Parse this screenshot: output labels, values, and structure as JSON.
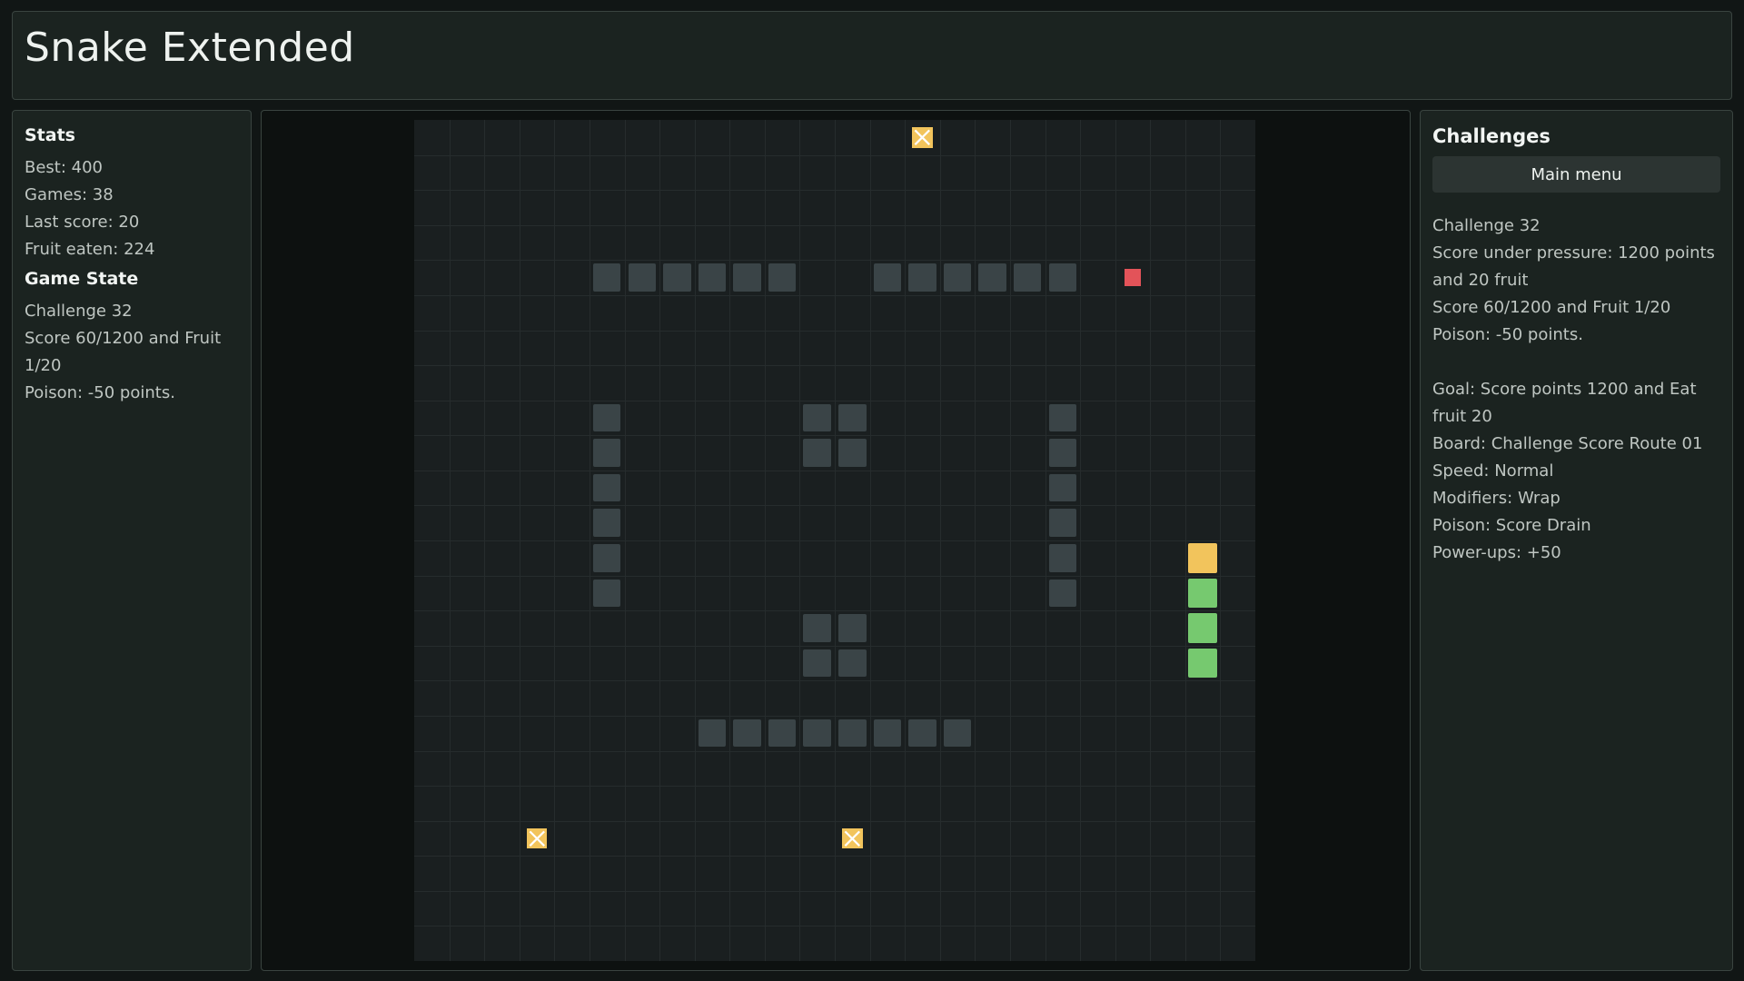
{
  "header": {
    "title": "Snake Extended"
  },
  "stats": {
    "title": "Stats",
    "lines": [
      "Best: 400",
      "Games: 38",
      "Last score: 20",
      "Fruit eaten: 224"
    ]
  },
  "game_state": {
    "title": "Game State",
    "lines": [
      "Challenge 32",
      "Score 60/1200 and Fruit 1/20",
      "Poison: -50 points."
    ]
  },
  "challenges": {
    "title": "Challenges",
    "main_menu_label": "Main menu",
    "summary": [
      "Challenge 32",
      "Score under pressure: 1200 points and 20 fruit",
      "Score 60/1200 and Fruit 1/20",
      "Poison: -50 points."
    ],
    "details": [
      "Goal: Score points 1200 and Eat fruit 20",
      "Board: Challenge Score Route 01",
      "Speed: Normal",
      "Modifiers: Wrap",
      "Poison: Score Drain",
      "Power-ups: +50"
    ]
  },
  "colors": {
    "wall": "#3a4447",
    "fruit": "#e35359",
    "snake_head": "#f2c45c",
    "snake_body": "#76c96f",
    "powerup": "#f2c45c",
    "board": "#1a1f20",
    "grid": "#262c2d"
  },
  "board": {
    "cols": 24,
    "rows": 24,
    "walls": [
      [
        5,
        4
      ],
      [
        6,
        4
      ],
      [
        7,
        4
      ],
      [
        8,
        4
      ],
      [
        9,
        4
      ],
      [
        10,
        4
      ],
      [
        13,
        4
      ],
      [
        14,
        4
      ],
      [
        15,
        4
      ],
      [
        16,
        4
      ],
      [
        17,
        4
      ],
      [
        18,
        4
      ],
      [
        5,
        8
      ],
      [
        5,
        9
      ],
      [
        5,
        10
      ],
      [
        5,
        11
      ],
      [
        5,
        12
      ],
      [
        5,
        13
      ],
      [
        18,
        8
      ],
      [
        18,
        9
      ],
      [
        18,
        10
      ],
      [
        18,
        11
      ],
      [
        18,
        12
      ],
      [
        18,
        13
      ],
      [
        11,
        8
      ],
      [
        12,
        8
      ],
      [
        11,
        9
      ],
      [
        12,
        9
      ],
      [
        11,
        14
      ],
      [
        12,
        14
      ],
      [
        11,
        15
      ],
      [
        12,
        15
      ],
      [
        8,
        17
      ],
      [
        9,
        17
      ],
      [
        10,
        17
      ],
      [
        11,
        17
      ],
      [
        12,
        17
      ],
      [
        13,
        17
      ],
      [
        14,
        17
      ],
      [
        15,
        17
      ]
    ],
    "fruit": [
      [
        20,
        4
      ]
    ],
    "snake": [
      [
        22,
        12
      ],
      [
        22,
        13
      ],
      [
        22,
        14
      ],
      [
        22,
        15
      ]
    ],
    "powerups": [
      [
        14,
        0
      ],
      [
        3,
        20
      ],
      [
        12,
        20
      ]
    ]
  }
}
